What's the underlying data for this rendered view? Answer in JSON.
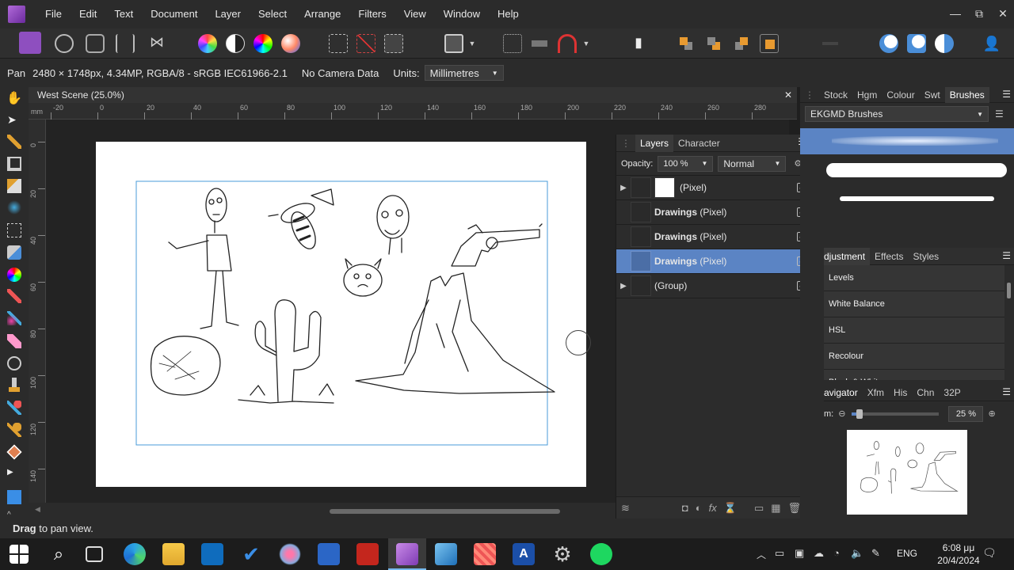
{
  "menu": [
    "File",
    "Edit",
    "Text",
    "Document",
    "Layer",
    "Select",
    "Arrange",
    "Filters",
    "View",
    "Window",
    "Help"
  ],
  "window_controls": {
    "minimize": "—",
    "maximize": "⧉",
    "close": "✕"
  },
  "context": {
    "tool": "Pan",
    "info": "2480 × 1748px, 4.34MP, RGBA/8 - sRGB IEC61966-2.1",
    "camera": "No Camera Data",
    "units_label": "Units:",
    "units_value": "Millimetres"
  },
  "document": {
    "tab_title": "West Scene (25.0%)",
    "close": "✕"
  },
  "ruler": {
    "unit": "mm",
    "h_ticks": [
      "-20",
      "0",
      "20",
      "40",
      "60",
      "80",
      "100",
      "120",
      "140",
      "160",
      "180",
      "200",
      "220",
      "240",
      "260",
      "280"
    ],
    "v_ticks": [
      "0",
      "20",
      "40",
      "60",
      "80",
      "100",
      "120",
      "140"
    ]
  },
  "status": {
    "bold": "Drag",
    "rest": "to pan view."
  },
  "layers_panel": {
    "tabs": [
      "Layers",
      "Character"
    ],
    "opacity_label": "Opacity:",
    "opacity_value": "100 %",
    "blend_mode": "Normal",
    "rows": [
      {
        "name": "(Pixel)",
        "bold": "",
        "expandable": true,
        "selected": false
      },
      {
        "name": "(Pixel)",
        "bold": "Drawings",
        "expandable": false,
        "selected": false
      },
      {
        "name": "(Pixel)",
        "bold": "Drawings",
        "expandable": false,
        "selected": false
      },
      {
        "name": "(Pixel)",
        "bold": "Drawings",
        "expandable": false,
        "selected": true
      },
      {
        "name": "(Group)",
        "bold": "",
        "expandable": true,
        "selected": false
      }
    ]
  },
  "brushes_panel": {
    "tabs": [
      "Stock",
      "Hgm",
      "Colour",
      "Swt",
      "Brushes"
    ],
    "category": "EKGMD Brushes"
  },
  "adjustment_panel": {
    "tabs": [
      "djustment",
      "Effects",
      "Styles"
    ],
    "items": [
      "Levels",
      "White Balance",
      "HSL",
      "Recolour",
      "Black & White"
    ]
  },
  "navigator_panel": {
    "tabs": [
      "avigator",
      "Xfm",
      "His",
      "Chn",
      "32P"
    ],
    "zoom_label": "m:",
    "zoom_value": "25 %"
  },
  "taskbar": {
    "lang": "ENG",
    "time": "6:08 μμ",
    "date": "20/4/2024"
  }
}
